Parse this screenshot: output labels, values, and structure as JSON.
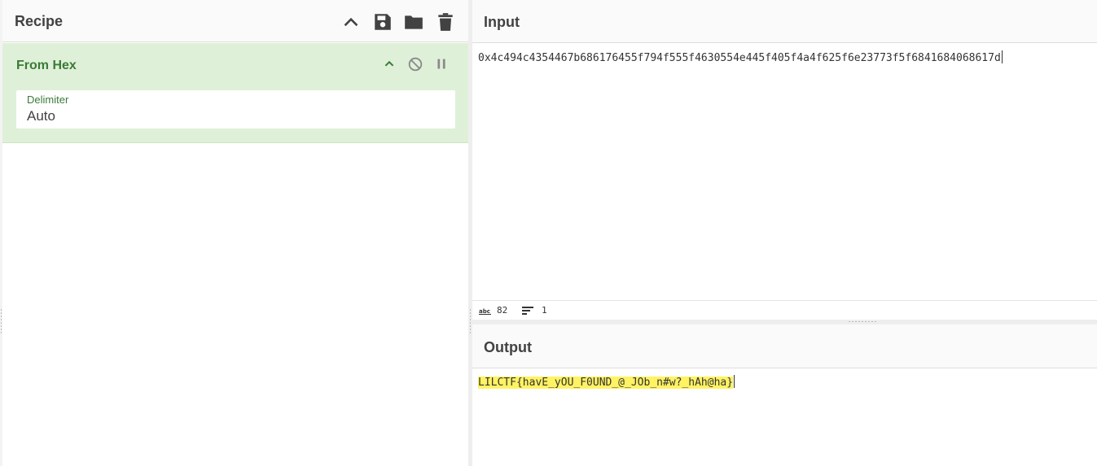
{
  "recipe": {
    "title": "Recipe",
    "icons": [
      "chevron-up-icon",
      "save-icon",
      "folder-icon",
      "trash-icon"
    ]
  },
  "operation": {
    "name": "From Hex",
    "icons": [
      "chevron-up-icon",
      "disable-icon",
      "pause-icon"
    ],
    "argument": {
      "label": "Delimiter",
      "value": "Auto"
    }
  },
  "input": {
    "title": "Input",
    "text": "0x4c494c4354467b686176455f794f555f4630554e445f405f4a4f625f6e23773f5f6841684068617d",
    "status": {
      "length_icon": "abc-length-icon",
      "length": "82",
      "lines_icon": "lines-icon",
      "lines": "1"
    }
  },
  "output": {
    "title": "Output",
    "text": "LILCTF{havE_yOU_F0UND_@_JOb_n#w?_hAh@ha}",
    "highlight_color": "#fff263"
  },
  "colors": {
    "accent_green": "#3c7a38",
    "operation_bg": "#dff0d8",
    "header_bg": "#fafafa"
  }
}
